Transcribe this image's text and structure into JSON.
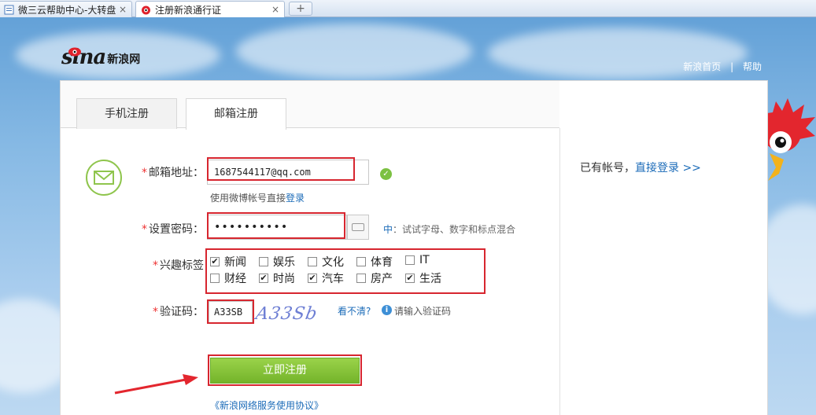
{
  "browser": {
    "tabs": [
      {
        "title": "微三云帮助中心-大转盘",
        "close": "×"
      },
      {
        "title": "注册新浪通行证",
        "close": "×"
      }
    ],
    "new_tab": "+"
  },
  "header": {
    "logo_text": "sina",
    "logo_cn": "新浪网",
    "links": [
      "新浪首页",
      "帮助"
    ],
    "separator": "|"
  },
  "register": {
    "tabs": [
      "手机注册",
      "邮箱注册"
    ],
    "active_tab": "邮箱注册",
    "email": {
      "label": "邮箱地址：",
      "value": "1687544117@qq.com",
      "hint_prefix": "使用微博帐号直接",
      "hint_link": "登录"
    },
    "password": {
      "label": "设置密码：",
      "value": "••••••••••",
      "strength_level": "中",
      "strength_text": "：试试字母、数字和标点混合"
    },
    "interests": {
      "label": "兴趣标签",
      "tags": [
        {
          "name": "新闻",
          "checked": true
        },
        {
          "name": "娱乐",
          "checked": false
        },
        {
          "name": "文化",
          "checked": false
        },
        {
          "name": "体育",
          "checked": false
        },
        {
          "name": "IT",
          "checked": false
        },
        {
          "name": "财经",
          "checked": false
        },
        {
          "name": "时尚",
          "checked": true
        },
        {
          "name": "汽车",
          "checked": true
        },
        {
          "name": "房产",
          "checked": false
        },
        {
          "name": "生活",
          "checked": true
        }
      ]
    },
    "captcha": {
      "label": "验证码：",
      "value": "A33SB",
      "image_text": "A33Sb",
      "refresh_link": "看不清?",
      "info": "请输入验证码"
    },
    "submit_label": "立即注册",
    "agreement": "《新浪网络服务使用协议》"
  },
  "sidebar": {
    "text": "已有帐号，",
    "link": "直接登录 >>"
  },
  "colors": {
    "accent_green": "#7cc142",
    "link_blue": "#1b6bb8",
    "highlight_red": "#d7262f"
  }
}
